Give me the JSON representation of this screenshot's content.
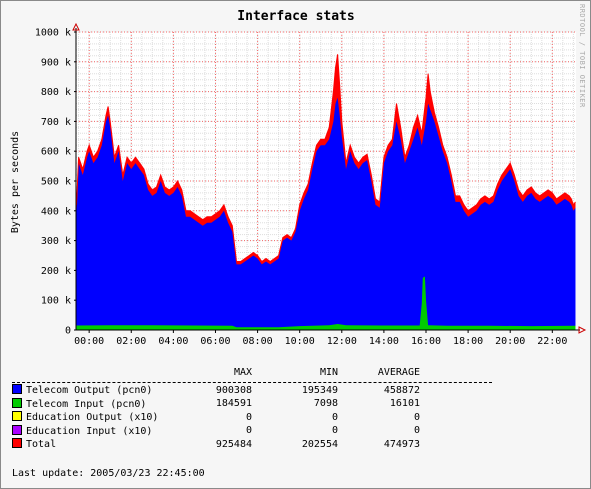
{
  "chart_data": {
    "type": "area",
    "title": "Interface stats",
    "ylabel": "Bytes per seconds",
    "ylim": [
      0,
      1000000
    ],
    "y_ticks": [
      "0",
      "100 k",
      "200 k",
      "300 k",
      "400 k",
      "500 k",
      "600 k",
      "700 k",
      "800 k",
      "900 k",
      "1000 k"
    ],
    "xlim": [
      -0.625,
      23.125
    ],
    "x_ticks": [
      "00:00",
      "02:00",
      "04:00",
      "06:00",
      "08:00",
      "10:00",
      "12:00",
      "14:00",
      "16:00",
      "18:00",
      "20:00",
      "22:00"
    ],
    "watermark": "RRDTOOL / TOBI OETIKER",
    "colors": {
      "telecom_output": "#0000ff",
      "telecom_input": "#00cc00",
      "total": "#ff0000",
      "education_output": "#ffff00",
      "education_input": "#aa00ff",
      "grid": "#ff0000",
      "canvas": "#ffffff"
    },
    "series": [
      {
        "name": "Telecom Output (pcn0)",
        "points": [
          [
            -0.6,
            400000
          ],
          [
            -0.5,
            560000
          ],
          [
            -0.3,
            520000
          ],
          [
            -0.1,
            580000
          ],
          [
            0.0,
            600000
          ],
          [
            0.2,
            560000
          ],
          [
            0.4,
            580000
          ],
          [
            0.6,
            620000
          ],
          [
            0.8,
            700000
          ],
          [
            0.9,
            720000
          ],
          [
            1.0,
            680000
          ],
          [
            1.2,
            560000
          ],
          [
            1.4,
            600000
          ],
          [
            1.6,
            500000
          ],
          [
            1.8,
            560000
          ],
          [
            2.0,
            540000
          ],
          [
            2.2,
            560000
          ],
          [
            2.4,
            540000
          ],
          [
            2.6,
            520000
          ],
          [
            2.8,
            470000
          ],
          [
            3.0,
            450000
          ],
          [
            3.2,
            460000
          ],
          [
            3.4,
            500000
          ],
          [
            3.6,
            460000
          ],
          [
            3.8,
            450000
          ],
          [
            4.0,
            460000
          ],
          [
            4.2,
            480000
          ],
          [
            4.4,
            450000
          ],
          [
            4.6,
            380000
          ],
          [
            4.8,
            380000
          ],
          [
            5.0,
            370000
          ],
          [
            5.2,
            360000
          ],
          [
            5.4,
            350000
          ],
          [
            5.6,
            360000
          ],
          [
            5.8,
            360000
          ],
          [
            6.0,
            370000
          ],
          [
            6.2,
            380000
          ],
          [
            6.4,
            400000
          ],
          [
            6.6,
            360000
          ],
          [
            6.8,
            330000
          ],
          [
            7.0,
            220000
          ],
          [
            7.2,
            220000
          ],
          [
            7.4,
            230000
          ],
          [
            7.6,
            240000
          ],
          [
            7.8,
            250000
          ],
          [
            8.0,
            240000
          ],
          [
            8.2,
            220000
          ],
          [
            8.4,
            230000
          ],
          [
            8.6,
            220000
          ],
          [
            8.8,
            230000
          ],
          [
            9.0,
            240000
          ],
          [
            9.2,
            300000
          ],
          [
            9.4,
            310000
          ],
          [
            9.6,
            300000
          ],
          [
            9.8,
            330000
          ],
          [
            10.0,
            400000
          ],
          [
            10.2,
            440000
          ],
          [
            10.4,
            470000
          ],
          [
            10.6,
            540000
          ],
          [
            10.8,
            600000
          ],
          [
            11.0,
            620000
          ],
          [
            11.2,
            620000
          ],
          [
            11.4,
            640000
          ],
          [
            11.6,
            700000
          ],
          [
            11.7,
            760000
          ],
          [
            11.8,
            780000
          ],
          [
            11.9,
            720000
          ],
          [
            12.0,
            650000
          ],
          [
            12.2,
            540000
          ],
          [
            12.4,
            600000
          ],
          [
            12.6,
            560000
          ],
          [
            12.8,
            540000
          ],
          [
            13.0,
            560000
          ],
          [
            13.2,
            570000
          ],
          [
            13.4,
            500000
          ],
          [
            13.6,
            420000
          ],
          [
            13.8,
            410000
          ],
          [
            14.0,
            560000
          ],
          [
            14.2,
            600000
          ],
          [
            14.4,
            620000
          ],
          [
            14.6,
            700000
          ],
          [
            14.8,
            640000
          ],
          [
            15.0,
            560000
          ],
          [
            15.2,
            600000
          ],
          [
            15.4,
            640000
          ],
          [
            15.6,
            680000
          ],
          [
            15.8,
            620000
          ],
          [
            16.0,
            700000
          ],
          [
            16.1,
            760000
          ],
          [
            16.2,
            740000
          ],
          [
            16.4,
            700000
          ],
          [
            16.6,
            650000
          ],
          [
            16.8,
            600000
          ],
          [
            17.0,
            560000
          ],
          [
            17.2,
            500000
          ],
          [
            17.4,
            430000
          ],
          [
            17.6,
            430000
          ],
          [
            17.8,
            400000
          ],
          [
            18.0,
            380000
          ],
          [
            18.2,
            390000
          ],
          [
            18.4,
            400000
          ],
          [
            18.6,
            420000
          ],
          [
            18.8,
            430000
          ],
          [
            19.0,
            420000
          ],
          [
            19.2,
            430000
          ],
          [
            19.4,
            470000
          ],
          [
            19.6,
            500000
          ],
          [
            19.8,
            520000
          ],
          [
            20.0,
            540000
          ],
          [
            20.2,
            500000
          ],
          [
            20.4,
            450000
          ],
          [
            20.6,
            430000
          ],
          [
            20.8,
            450000
          ],
          [
            21.0,
            460000
          ],
          [
            21.2,
            440000
          ],
          [
            21.4,
            430000
          ],
          [
            21.6,
            440000
          ],
          [
            21.8,
            450000
          ],
          [
            22.0,
            440000
          ],
          [
            22.2,
            420000
          ],
          [
            22.4,
            430000
          ],
          [
            22.6,
            440000
          ],
          [
            22.8,
            430000
          ],
          [
            22.9,
            420000
          ],
          [
            23.0,
            400000
          ],
          [
            23.1,
            410000
          ]
        ]
      },
      {
        "name": "Telecom Input (pcn0)",
        "points": [
          [
            -0.6,
            15000
          ],
          [
            1.0,
            16000
          ],
          [
            3.0,
            16000
          ],
          [
            5.0,
            15000
          ],
          [
            6.8,
            14000
          ],
          [
            7.0,
            9000
          ],
          [
            9.0,
            9000
          ],
          [
            10.0,
            13000
          ],
          [
            11.4,
            16000
          ],
          [
            11.8,
            20000
          ],
          [
            12.2,
            16000
          ],
          [
            14.0,
            15000
          ],
          [
            15.7,
            15000
          ],
          [
            15.8,
            90000
          ],
          [
            15.85,
            175000
          ],
          [
            15.95,
            180000
          ],
          [
            16.0,
            100000
          ],
          [
            16.1,
            16000
          ],
          [
            17.0,
            14000
          ],
          [
            19.0,
            14000
          ],
          [
            21.0,
            13000
          ],
          [
            23.1,
            14000
          ]
        ]
      },
      {
        "name": "Education Output (x10)",
        "points": [
          [
            -0.6,
            0
          ],
          [
            23.1,
            0
          ]
        ]
      },
      {
        "name": "Education Input (x10)",
        "points": [
          [
            -0.6,
            0
          ],
          [
            23.1,
            0
          ]
        ]
      },
      {
        "name": "Total",
        "points": [
          [
            -0.6,
            420000
          ],
          [
            -0.5,
            580000
          ],
          [
            -0.3,
            540000
          ],
          [
            -0.1,
            600000
          ],
          [
            0.0,
            620000
          ],
          [
            0.2,
            580000
          ],
          [
            0.4,
            600000
          ],
          [
            0.6,
            640000
          ],
          [
            0.8,
            720000
          ],
          [
            0.9,
            750000
          ],
          [
            1.0,
            700000
          ],
          [
            1.2,
            580000
          ],
          [
            1.4,
            620000
          ],
          [
            1.6,
            520000
          ],
          [
            1.8,
            580000
          ],
          [
            2.0,
            560000
          ],
          [
            2.2,
            580000
          ],
          [
            2.4,
            560000
          ],
          [
            2.6,
            540000
          ],
          [
            2.8,
            490000
          ],
          [
            3.0,
            470000
          ],
          [
            3.2,
            480000
          ],
          [
            3.4,
            520000
          ],
          [
            3.6,
            480000
          ],
          [
            3.8,
            470000
          ],
          [
            4.0,
            480000
          ],
          [
            4.2,
            500000
          ],
          [
            4.4,
            470000
          ],
          [
            4.6,
            400000
          ],
          [
            4.8,
            400000
          ],
          [
            5.0,
            390000
          ],
          [
            5.2,
            380000
          ],
          [
            5.4,
            370000
          ],
          [
            5.6,
            380000
          ],
          [
            5.8,
            380000
          ],
          [
            6.0,
            390000
          ],
          [
            6.2,
            400000
          ],
          [
            6.4,
            420000
          ],
          [
            6.6,
            380000
          ],
          [
            6.8,
            350000
          ],
          [
            7.0,
            230000
          ],
          [
            7.2,
            230000
          ],
          [
            7.4,
            240000
          ],
          [
            7.6,
            250000
          ],
          [
            7.8,
            260000
          ],
          [
            8.0,
            250000
          ],
          [
            8.2,
            230000
          ],
          [
            8.4,
            240000
          ],
          [
            8.6,
            230000
          ],
          [
            8.8,
            240000
          ],
          [
            9.0,
            250000
          ],
          [
            9.2,
            310000
          ],
          [
            9.4,
            320000
          ],
          [
            9.6,
            310000
          ],
          [
            9.8,
            340000
          ],
          [
            10.0,
            420000
          ],
          [
            10.2,
            460000
          ],
          [
            10.4,
            490000
          ],
          [
            10.6,
            560000
          ],
          [
            10.8,
            620000
          ],
          [
            11.0,
            640000
          ],
          [
            11.2,
            640000
          ],
          [
            11.4,
            680000
          ],
          [
            11.6,
            800000
          ],
          [
            11.7,
            880000
          ],
          [
            11.8,
            925000
          ],
          [
            11.9,
            820000
          ],
          [
            12.0,
            700000
          ],
          [
            12.2,
            560000
          ],
          [
            12.4,
            620000
          ],
          [
            12.6,
            580000
          ],
          [
            12.8,
            560000
          ],
          [
            13.0,
            580000
          ],
          [
            13.2,
            590000
          ],
          [
            13.4,
            520000
          ],
          [
            13.6,
            440000
          ],
          [
            13.8,
            430000
          ],
          [
            14.0,
            580000
          ],
          [
            14.2,
            620000
          ],
          [
            14.4,
            640000
          ],
          [
            14.6,
            760000
          ],
          [
            14.8,
            680000
          ],
          [
            15.0,
            580000
          ],
          [
            15.2,
            620000
          ],
          [
            15.4,
            680000
          ],
          [
            15.6,
            720000
          ],
          [
            15.8,
            660000
          ],
          [
            16.0,
            780000
          ],
          [
            16.1,
            860000
          ],
          [
            16.2,
            800000
          ],
          [
            16.4,
            730000
          ],
          [
            16.6,
            680000
          ],
          [
            16.8,
            620000
          ],
          [
            17.0,
            580000
          ],
          [
            17.2,
            520000
          ],
          [
            17.4,
            450000
          ],
          [
            17.6,
            450000
          ],
          [
            17.8,
            420000
          ],
          [
            18.0,
            400000
          ],
          [
            18.2,
            410000
          ],
          [
            18.4,
            420000
          ],
          [
            18.6,
            440000
          ],
          [
            18.8,
            450000
          ],
          [
            19.0,
            440000
          ],
          [
            19.2,
            450000
          ],
          [
            19.4,
            490000
          ],
          [
            19.6,
            520000
          ],
          [
            19.8,
            540000
          ],
          [
            20.0,
            560000
          ],
          [
            20.2,
            520000
          ],
          [
            20.4,
            470000
          ],
          [
            20.6,
            450000
          ],
          [
            20.8,
            470000
          ],
          [
            21.0,
            480000
          ],
          [
            21.2,
            460000
          ],
          [
            21.4,
            450000
          ],
          [
            21.6,
            460000
          ],
          [
            21.8,
            470000
          ],
          [
            22.0,
            460000
          ],
          [
            22.2,
            440000
          ],
          [
            22.4,
            450000
          ],
          [
            22.6,
            460000
          ],
          [
            22.8,
            450000
          ],
          [
            22.9,
            440000
          ],
          [
            23.0,
            420000
          ],
          [
            23.1,
            430000
          ]
        ]
      }
    ]
  },
  "legend": {
    "headers": {
      "max": "MAX",
      "min": "MIN",
      "avg": "AVERAGE"
    },
    "rows": [
      {
        "label": "Telecom Output (pcn0)",
        "color": "#0000ff",
        "max": "900308",
        "min": "195349",
        "avg": "458872"
      },
      {
        "label": "Telecom Input (pcn0)",
        "color": "#00cc00",
        "max": "184591",
        "min": "7098",
        "avg": "16101"
      },
      {
        "label": "Education Output (x10)",
        "color": "#ffff00",
        "max": "0",
        "min": "0",
        "avg": "0"
      },
      {
        "label": "Education Input (x10)",
        "color": "#aa00ff",
        "max": "0",
        "min": "0",
        "avg": "0"
      },
      {
        "label": "Total",
        "color": "#ff0000",
        "max": "925484",
        "min": "202554",
        "avg": "474973"
      }
    ]
  },
  "last_update": "Last update: 2005/03/23 22:45:00"
}
